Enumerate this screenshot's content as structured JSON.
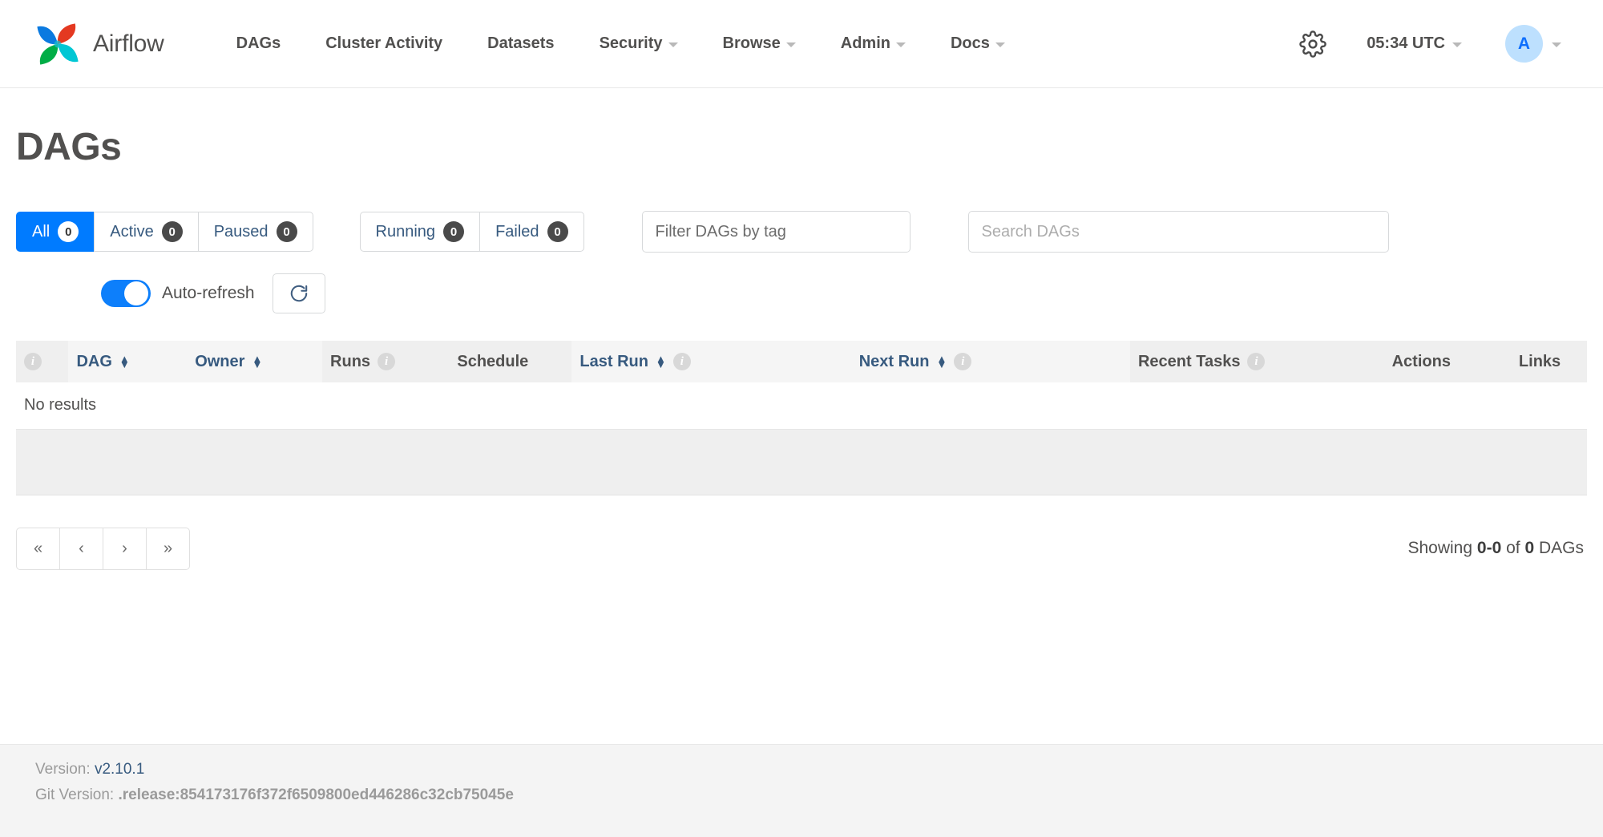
{
  "navbar": {
    "brand_label": "Airflow",
    "logo_icon": "airflow-pinwheel-logo",
    "links": [
      {
        "label": "DAGs",
        "has_caret": false
      },
      {
        "label": "Cluster Activity",
        "has_caret": false
      },
      {
        "label": "Datasets",
        "has_caret": false
      },
      {
        "label": "Security",
        "has_caret": true
      },
      {
        "label": "Browse",
        "has_caret": true
      },
      {
        "label": "Admin",
        "has_caret": true
      },
      {
        "label": "Docs",
        "has_caret": true
      }
    ],
    "gear_icon": "gear-icon",
    "clock_label": "05:34 UTC",
    "avatar_initial": "A"
  },
  "main": {
    "page_title": "DAGs",
    "status_filters": [
      {
        "label": "All",
        "count": "0",
        "active": true
      },
      {
        "label": "Active",
        "count": "0",
        "active": false
      },
      {
        "label": "Paused",
        "count": "0",
        "active": false
      }
    ],
    "run_filters": [
      {
        "label": "Running",
        "count": "0"
      },
      {
        "label": "Failed",
        "count": "0"
      }
    ],
    "tag_filter_placeholder": "Filter DAGs by tag",
    "tag_filter_value": "",
    "search_placeholder": "Search DAGs",
    "search_value": "",
    "auto_refresh_label": "Auto-refresh",
    "auto_refresh_on": true,
    "refresh_button_icon": "refresh-icon",
    "table": {
      "columns": [
        {
          "label": "",
          "icon": "info-icon",
          "sortable": false
        },
        {
          "label": "DAG",
          "sortable": true
        },
        {
          "label": "Owner",
          "sortable": true
        },
        {
          "label": "Runs",
          "icon": "info-icon",
          "sortable": false
        },
        {
          "label": "Schedule",
          "sortable": false
        },
        {
          "label": "Last Run",
          "icon": "info-icon",
          "sortable": true
        },
        {
          "label": "Next Run",
          "icon": "info-icon",
          "sortable": true
        },
        {
          "label": "Recent Tasks",
          "icon": "info-icon",
          "sortable": false
        },
        {
          "label": "Actions",
          "sortable": false
        },
        {
          "label": "Links",
          "sortable": false
        }
      ],
      "empty_message": "No results",
      "rows": []
    },
    "pagination": {
      "buttons": [
        {
          "label": "«",
          "name": "first-page"
        },
        {
          "label": "‹",
          "name": "prev-page"
        },
        {
          "label": "›",
          "name": "next-page"
        },
        {
          "label": "»",
          "name": "last-page"
        }
      ],
      "showing_prefix": "Showing",
      "showing_range": "0-0",
      "showing_middle": "of",
      "showing_total": "0",
      "showing_suffix": "DAGs"
    }
  },
  "footer": {
    "version_label": "Version:",
    "version_value": "v2.10.1",
    "git_label": "Git Version:",
    "git_value": ".release:854173176f372f6509800ed446286c32cb75045e"
  },
  "colors": {
    "accent_blue": "#007bff",
    "link_blue": "#375a7f",
    "avatar_bg": "#bde0fe",
    "toggle_on": "#0d7ffb",
    "header_bg": "#efefef"
  }
}
